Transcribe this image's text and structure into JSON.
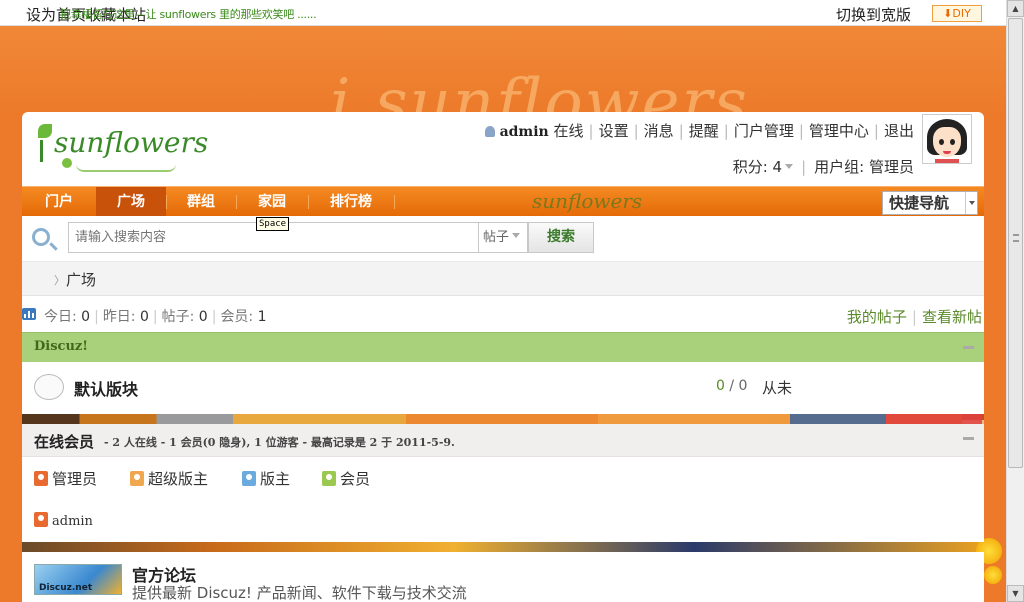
{
  "topbar": {
    "set_home": "设为首页",
    "bookmark": "收藏本站",
    "marquee": "把幸福留在这里—让 sunflowers 里的那些欢笑吧 ......",
    "switch_wide": "切换到宽版",
    "diy": "DIY"
  },
  "header": {
    "logo_text": "sunflowers",
    "username": "admin",
    "status": "在线",
    "links": [
      "设置",
      "消息",
      "提醒",
      "门户管理",
      "管理中心",
      "退出"
    ],
    "points_label": "积分: 4",
    "usergroup": "用户组: 管理员"
  },
  "nav": {
    "items": [
      "门户",
      "广场",
      "群组",
      "家园",
      "排行榜"
    ],
    "active_index": 1,
    "tooltip": "Space",
    "quick_nav": "快捷导航"
  },
  "search": {
    "placeholder": "请输入搜索内容",
    "scope": "帖子",
    "button": "搜索"
  },
  "breadcrumb": {
    "current": "广场"
  },
  "stats": {
    "today_label": "今日:",
    "today": "0",
    "yesterday_label": "昨日:",
    "yesterday": "0",
    "posts_label": "帖子:",
    "posts": "0",
    "members_label": "会员:",
    "members": "1",
    "my_posts": "我的帖子",
    "new_posts": "查看新帖"
  },
  "category": {
    "title": "Discuz!",
    "forum": {
      "name": "默认版块",
      "threads": "0",
      "posts": "0",
      "last_post": "从未"
    }
  },
  "online": {
    "title": "在线会员",
    "detail": "- 2 人在线 - 1 会员(0 隐身), 1 位游客 - 最高记录是 2 于 2011-5-9.",
    "legend": [
      "管理员",
      "超级版主",
      "版主",
      "会员"
    ],
    "members": [
      "admin"
    ]
  },
  "links_section": {
    "image_text": "Discuz.net",
    "name": "官方论坛",
    "desc": "提供最新 Discuz! 产品新闻、软件下载与技术交流"
  },
  "colors": {
    "nav_orange": "#e46a08",
    "category_green": "#a9d07a",
    "page_bg_orange": "#ec7a2a",
    "link_green": "#5a8a2a"
  }
}
